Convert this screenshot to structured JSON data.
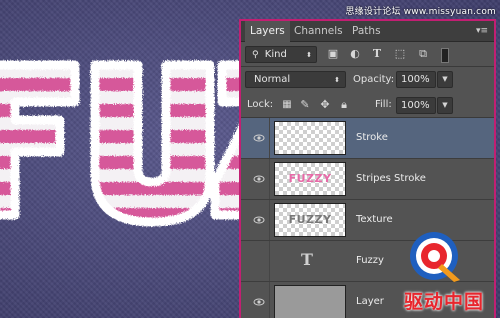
{
  "watermark": "思缘设计论坛 www.missyuan.com",
  "artwork": {
    "text": "FUZZ",
    "stripe_color": "#d6589a",
    "fur_color": "#ffffff"
  },
  "tabs": [
    {
      "label": "Layers",
      "active": true
    },
    {
      "label": "Channels",
      "active": false
    },
    {
      "label": "Paths",
      "active": false
    }
  ],
  "filter": {
    "kind": "Kind"
  },
  "blend": {
    "mode": "Normal",
    "opacity_label": "Opacity:",
    "opacity_value": "100%"
  },
  "lock": {
    "label": "Lock:",
    "fill_label": "Fill:",
    "fill_value": "100%"
  },
  "layers": [
    {
      "name": "Stroke",
      "selected": true,
      "thumb": "transparent",
      "thumb_text": ""
    },
    {
      "name": "Stripes Stroke",
      "selected": false,
      "thumb": "transparent",
      "thumb_text": "FUZZY"
    },
    {
      "name": "Texture",
      "selected": false,
      "thumb": "transparent",
      "thumb_text": "FUZZY"
    },
    {
      "name": "Fuzzy",
      "selected": false,
      "thumb": "text-layer",
      "thumb_text": ""
    },
    {
      "name": "Layer",
      "selected": false,
      "thumb": "gray",
      "thumb_text": ""
    }
  ],
  "brand": {
    "text": "驱动中国",
    "color": "#e8262d"
  },
  "icons": [
    "eye-icon",
    "panel-menu-icon",
    "image-filter-icon",
    "adjustment-filter-icon",
    "type-filter-icon",
    "shape-filter-icon",
    "smart-object-filter-icon",
    "lock-transparent-icon",
    "lock-paint-icon",
    "lock-move-icon",
    "lock-all-icon",
    "type-layer-icon"
  ]
}
